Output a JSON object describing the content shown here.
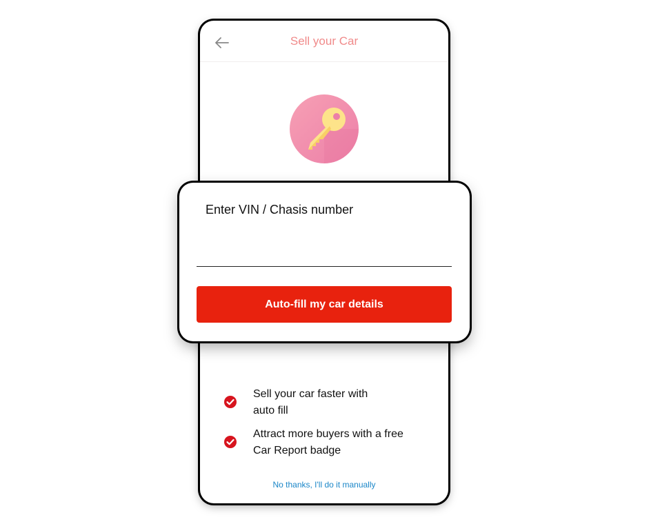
{
  "header": {
    "title": "Sell your Car",
    "back_icon": "arrow-left-icon"
  },
  "hero": {
    "icon": "key-icon",
    "circle_color": "#f08fb0",
    "key_color": "#fde38a"
  },
  "vin_card": {
    "label": "Enter VIN / Chasis number",
    "input_value": "",
    "button_label": "Auto-fill my car details",
    "button_color": "#e8220e"
  },
  "benefits": [
    {
      "line1": "Sell your car faster with",
      "line2": "auto fill",
      "icon": "check-circle-icon"
    },
    {
      "line1": "Attract more buyers with a free",
      "line2": "Car Report badge",
      "icon": "check-circle-icon"
    }
  ],
  "footer": {
    "manual_link": "No thanks, I'll do it manually",
    "link_color": "#1a86c8"
  },
  "colors": {
    "title": "#f08a8a",
    "check": "#d7141e"
  }
}
